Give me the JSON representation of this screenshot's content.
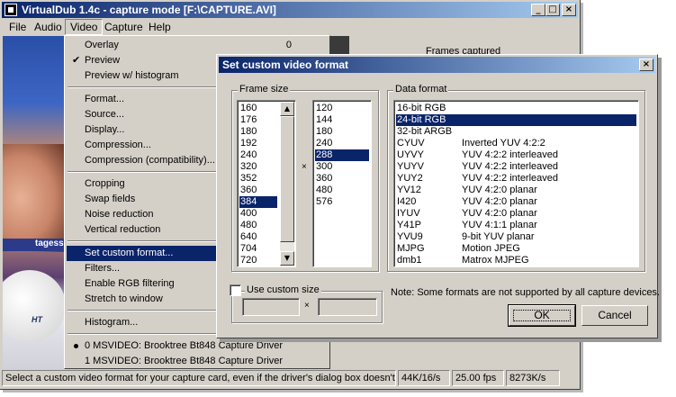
{
  "window": {
    "title": "VirtualDub 1.4c - capture mode [F:\\CAPTURE.AVI]"
  },
  "caption_buttons": {
    "minimize": "_",
    "maximize": "□",
    "close": "×"
  },
  "menubar": [
    {
      "label": "File"
    },
    {
      "label": "Audio"
    },
    {
      "label": "Video"
    },
    {
      "label": "Capture"
    },
    {
      "label": "Help"
    }
  ],
  "preview": {
    "overlay_text": "tagess",
    "logo_text": "HT"
  },
  "side_panel": {
    "value": "0",
    "label": "Frames captured"
  },
  "video_menu": {
    "items": [
      {
        "label": "Overlay"
      },
      {
        "label": "Preview",
        "checked": "✔"
      },
      {
        "label": "Preview w/ histogram"
      },
      {
        "label": "Format..."
      },
      {
        "label": "Source..."
      },
      {
        "label": "Display..."
      },
      {
        "label": "Compression..."
      },
      {
        "label": "Compression (compatibility)..."
      },
      {
        "label": "Cropping"
      },
      {
        "label": "Swap fields"
      },
      {
        "label": "Noise reduction"
      },
      {
        "label": "Vertical reduction"
      },
      {
        "label": "Set custom format..."
      },
      {
        "label": "Filters..."
      },
      {
        "label": "Enable RGB filtering"
      },
      {
        "label": "Stretch to window"
      },
      {
        "label": "Histogram..."
      },
      {
        "label": "0 MSVIDEO: Brooktree Bt848 Capture Driver"
      },
      {
        "label": "1 MSVIDEO: Brooktree Bt848 Capture Driver"
      }
    ]
  },
  "statusbar": {
    "message": "Select a custom video format for your capture card, even if the driver's dialog box doesn't allow it.",
    "audio": "44K/16/s",
    "fps": "25.00 fps",
    "rate": "8273K/s"
  },
  "dialog": {
    "title": "Set custom video format",
    "close": "×",
    "frame_size_label": "Frame size",
    "widths": [
      "160",
      "176",
      "180",
      "192",
      "240",
      "320",
      "352",
      "360",
      "384",
      "400",
      "480",
      "640",
      "704",
      "720"
    ],
    "selected_width": "384",
    "heights": [
      "120",
      "144",
      "180",
      "240",
      "288",
      "300",
      "360",
      "480",
      "576"
    ],
    "selected_height": "288",
    "times": "×",
    "data_format_label": "Data format",
    "formats": [
      {
        "code": "16-bit RGB",
        "desc": ""
      },
      {
        "code": "24-bit RGB",
        "desc": ""
      },
      {
        "code": "32-bit ARGB",
        "desc": ""
      },
      {
        "code": "CYUV",
        "desc": "Inverted YUV 4:2:2"
      },
      {
        "code": "UYVY",
        "desc": "YUV 4:2:2 interleaved"
      },
      {
        "code": "YUYV",
        "desc": "YUV 4:2:2 interleaved"
      },
      {
        "code": "YUY2",
        "desc": "YUV 4:2:2 interleaved"
      },
      {
        "code": "YV12",
        "desc": "YUV 4:2:0 planar"
      },
      {
        "code": "I420",
        "desc": "YUV 4:2:0 planar"
      },
      {
        "code": "IYUV",
        "desc": "YUV 4:2:0 planar"
      },
      {
        "code": "Y41P",
        "desc": "YUV 4:1:1 planar"
      },
      {
        "code": "YVU9",
        "desc": "9-bit YUV planar"
      },
      {
        "code": "MJPG",
        "desc": "Motion JPEG"
      },
      {
        "code": "dmb1",
        "desc": "Matrox MJPEG"
      }
    ],
    "selected_format": "24-bit RGB",
    "custom_size_label": "Use custom size",
    "custom_times": "×",
    "custom_width_value": "",
    "custom_height_value": "",
    "note": "Note: Some formats are not supported by all capture devices.",
    "ok": "OK",
    "cancel": "Cancel",
    "scroll_up": "▲",
    "scroll_down": "▼"
  }
}
